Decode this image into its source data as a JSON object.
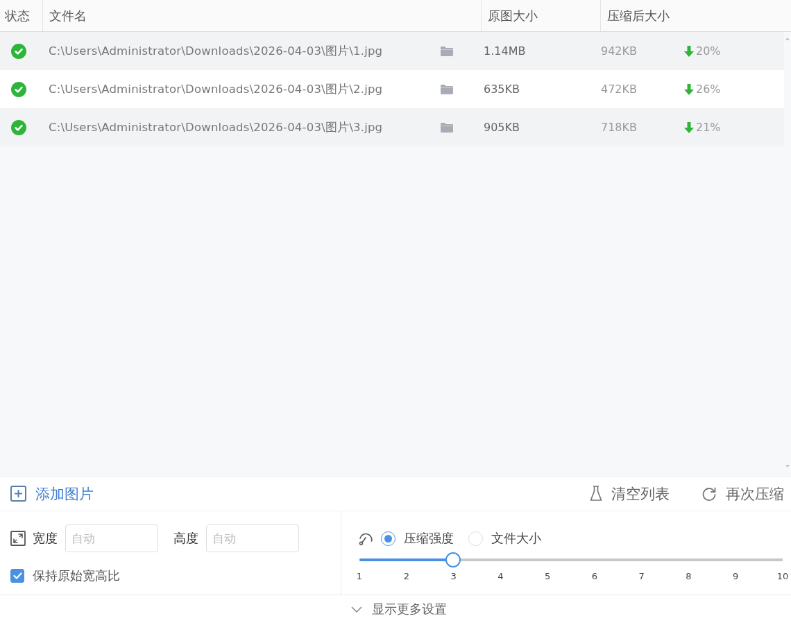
{
  "table": {
    "columns": [
      "状态",
      "文件名",
      "原图大小",
      "压缩后大小"
    ],
    "rows": [
      {
        "completed": true,
        "path": "C:\\Users\\Administrator\\Downloads\\2026-04-03\\图片\\1.jpg",
        "original_size": "1.14MB",
        "compressed_size": "942KB",
        "reduction": "20%"
      },
      {
        "completed": true,
        "path": "C:\\Users\\Administrator\\Downloads\\2026-04-03\\图片\\2.jpg",
        "original_size": "635KB",
        "compressed_size": "472KB",
        "reduction": "26%"
      },
      {
        "completed": true,
        "path": "C:\\Users\\Administrator\\Downloads\\2026-04-03\\图片\\3.jpg",
        "original_size": "905KB",
        "compressed_size": "718KB",
        "reduction": "21%"
      }
    ]
  },
  "toolbar": {
    "add": "添加图片",
    "clear": "清空列表",
    "recompress": "再次压缩"
  },
  "resize": {
    "width": {
      "label": "宽度",
      "placeholder": "自动"
    },
    "height": {
      "label": "高度",
      "placeholder": "自动"
    },
    "keep_ratio": {
      "label": "保持原始宽高比",
      "checked": true
    }
  },
  "compression": {
    "modes": [
      {
        "label": "压缩强度",
        "selected": true
      },
      {
        "label": "文件大小",
        "selected": false
      }
    ],
    "slider": {
      "level": 0.222,
      "ticks": [
        "1",
        "2",
        "3",
        "4",
        "5",
        "6",
        "7",
        "8",
        "9",
        "10"
      ]
    }
  },
  "more_settings": "显示更多设置"
}
